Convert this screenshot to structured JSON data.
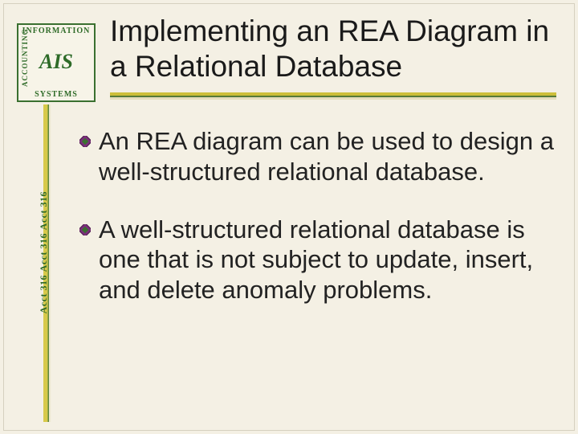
{
  "logo": {
    "top_text": "INFORMATION",
    "bottom_text": "SYSTEMS",
    "left_text": "ACCOUNTING",
    "right_text": "",
    "center_text": "AIS"
  },
  "course_code": "Acct 316",
  "title": "Implementing an REA Diagram in a Relational Database",
  "bullets": [
    "An REA diagram can be used to design a well-structured relational database.",
    "A well-structured relational database is one that is not subject to update, insert, and delete anomaly problems."
  ],
  "colors": {
    "accent_yellow": "#cdbf3a",
    "accent_green": "#567a3a",
    "logo_green": "#2f6b28",
    "background": "#f4f0e4"
  }
}
